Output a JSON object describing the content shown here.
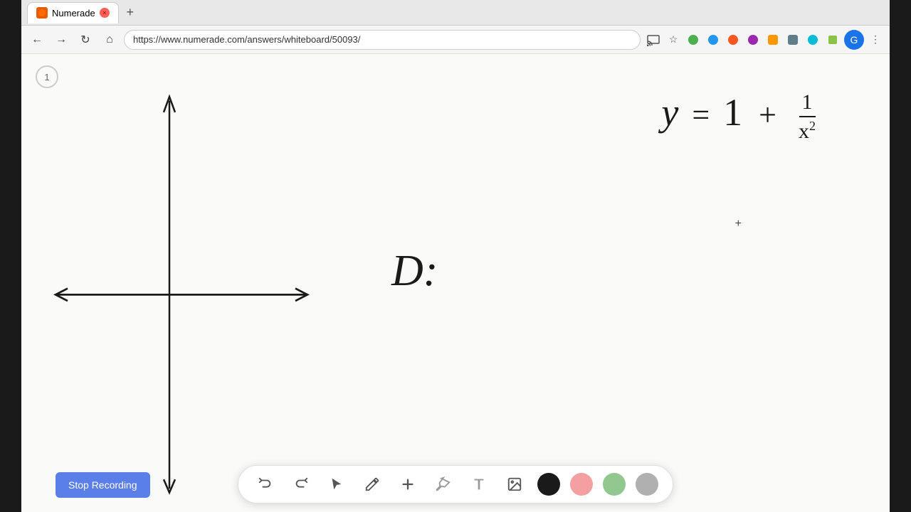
{
  "browser": {
    "tab_title": "Numerade",
    "tab_favicon_color": "#e85d04",
    "url": "https://www.numerade.com/answers/whiteboard/50093/",
    "profile_letter": "G"
  },
  "toolbar": {
    "undo_label": "↺",
    "redo_label": "↻",
    "stop_recording_label": "Stop Recording"
  },
  "page": {
    "number": "1",
    "formula_y": "y =",
    "formula_1": "1",
    "formula_plus": "+",
    "fraction_numerator": "1",
    "fraction_denominator": "x",
    "fraction_exponent": "2",
    "domain_label": "D:"
  },
  "colors": {
    "black": "#1a1a1a",
    "pink": "#f4a0a0",
    "green": "#90c890",
    "gray": "#b0b0b0",
    "stop_btn_bg": "#5b7fe8"
  }
}
